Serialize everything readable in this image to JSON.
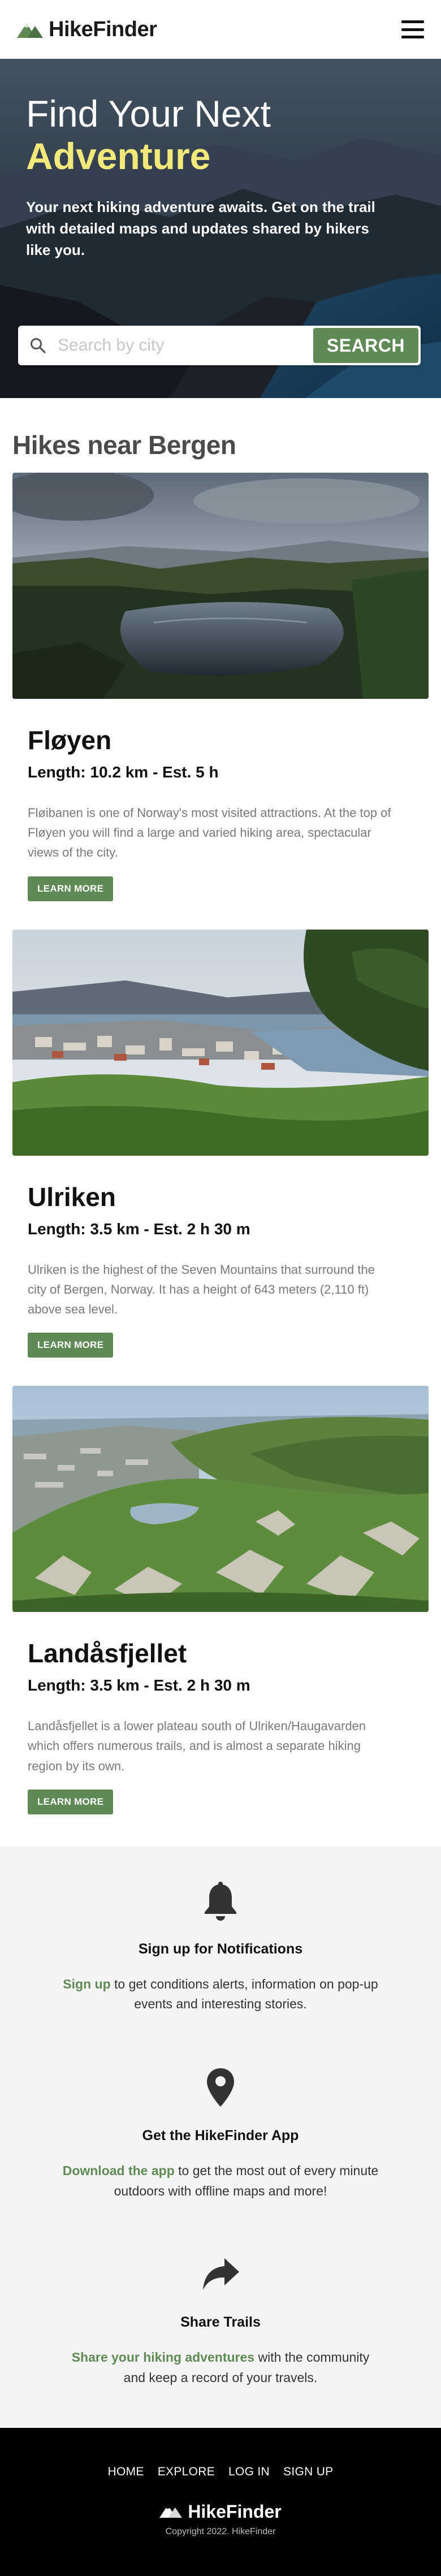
{
  "header": {
    "brand_name": "HikeFinder"
  },
  "hero": {
    "title_line1": "Find Your Next",
    "title_line2": "Adventure",
    "subtitle": "Your next hiking adventure awaits. Get on the trail with detailed maps and updates shared by hikers like you.",
    "search_placeholder": "Search by city",
    "search_value": "",
    "search_button": "SEARCH"
  },
  "section": {
    "title": "Hikes near Bergen"
  },
  "hikes": [
    {
      "name": "Fløyen",
      "meta": "Length: 10.2 km - Est. 5 h",
      "description": "Fløibanen is one of Norway's most visited attractions. At the top of Fløyen you will find a large and varied hiking area, spectacular views of the city.",
      "button": "LEARN MORE"
    },
    {
      "name": "Ulriken",
      "meta": "Length: 3.5 km - Est. 2 h 30 m",
      "description": "Ulriken is the highest of the Seven Mountains that surround the city of Bergen, Norway. It has a height of 643 meters (2,110 ft) above sea level.",
      "button": "LEARN MORE"
    },
    {
      "name": "Landåsfjellet",
      "meta": "Length: 3.5 km - Est. 2 h 30 m",
      "description": "Landåsfjellet is a lower plateau south of Ulriken/Haugavarden which offers numerous trails, and is almost a separate hiking region by its own.",
      "button": "LEARN MORE"
    }
  ],
  "features": [
    {
      "icon": "bell-icon",
      "title": "Sign up for Notifications",
      "link": "Sign up",
      "text": " to get conditions alerts, information on pop-up events and interesting stories."
    },
    {
      "icon": "map-pin-icon",
      "title": "Get the HikeFinder App",
      "link": "Download the app",
      "text": " to get the most out of every minute outdoors with offline maps and more!"
    },
    {
      "icon": "share-icon",
      "title": "Share Trails",
      "link": "Share your hiking adventures",
      "text": " with the community and keep a record of your travels."
    }
  ],
  "footer": {
    "nav": [
      "HOME",
      "EXPLORE",
      "LOG IN",
      "SIGN UP"
    ],
    "brand_name": "HikeFinder",
    "copyright": "Copyright 2022. HikeFinder"
  },
  "colors": {
    "accent": "#5f8a55",
    "hero_highlight": "#f2e97a",
    "footer_bg": "#000000",
    "features_bg": "#f4f4f4"
  }
}
